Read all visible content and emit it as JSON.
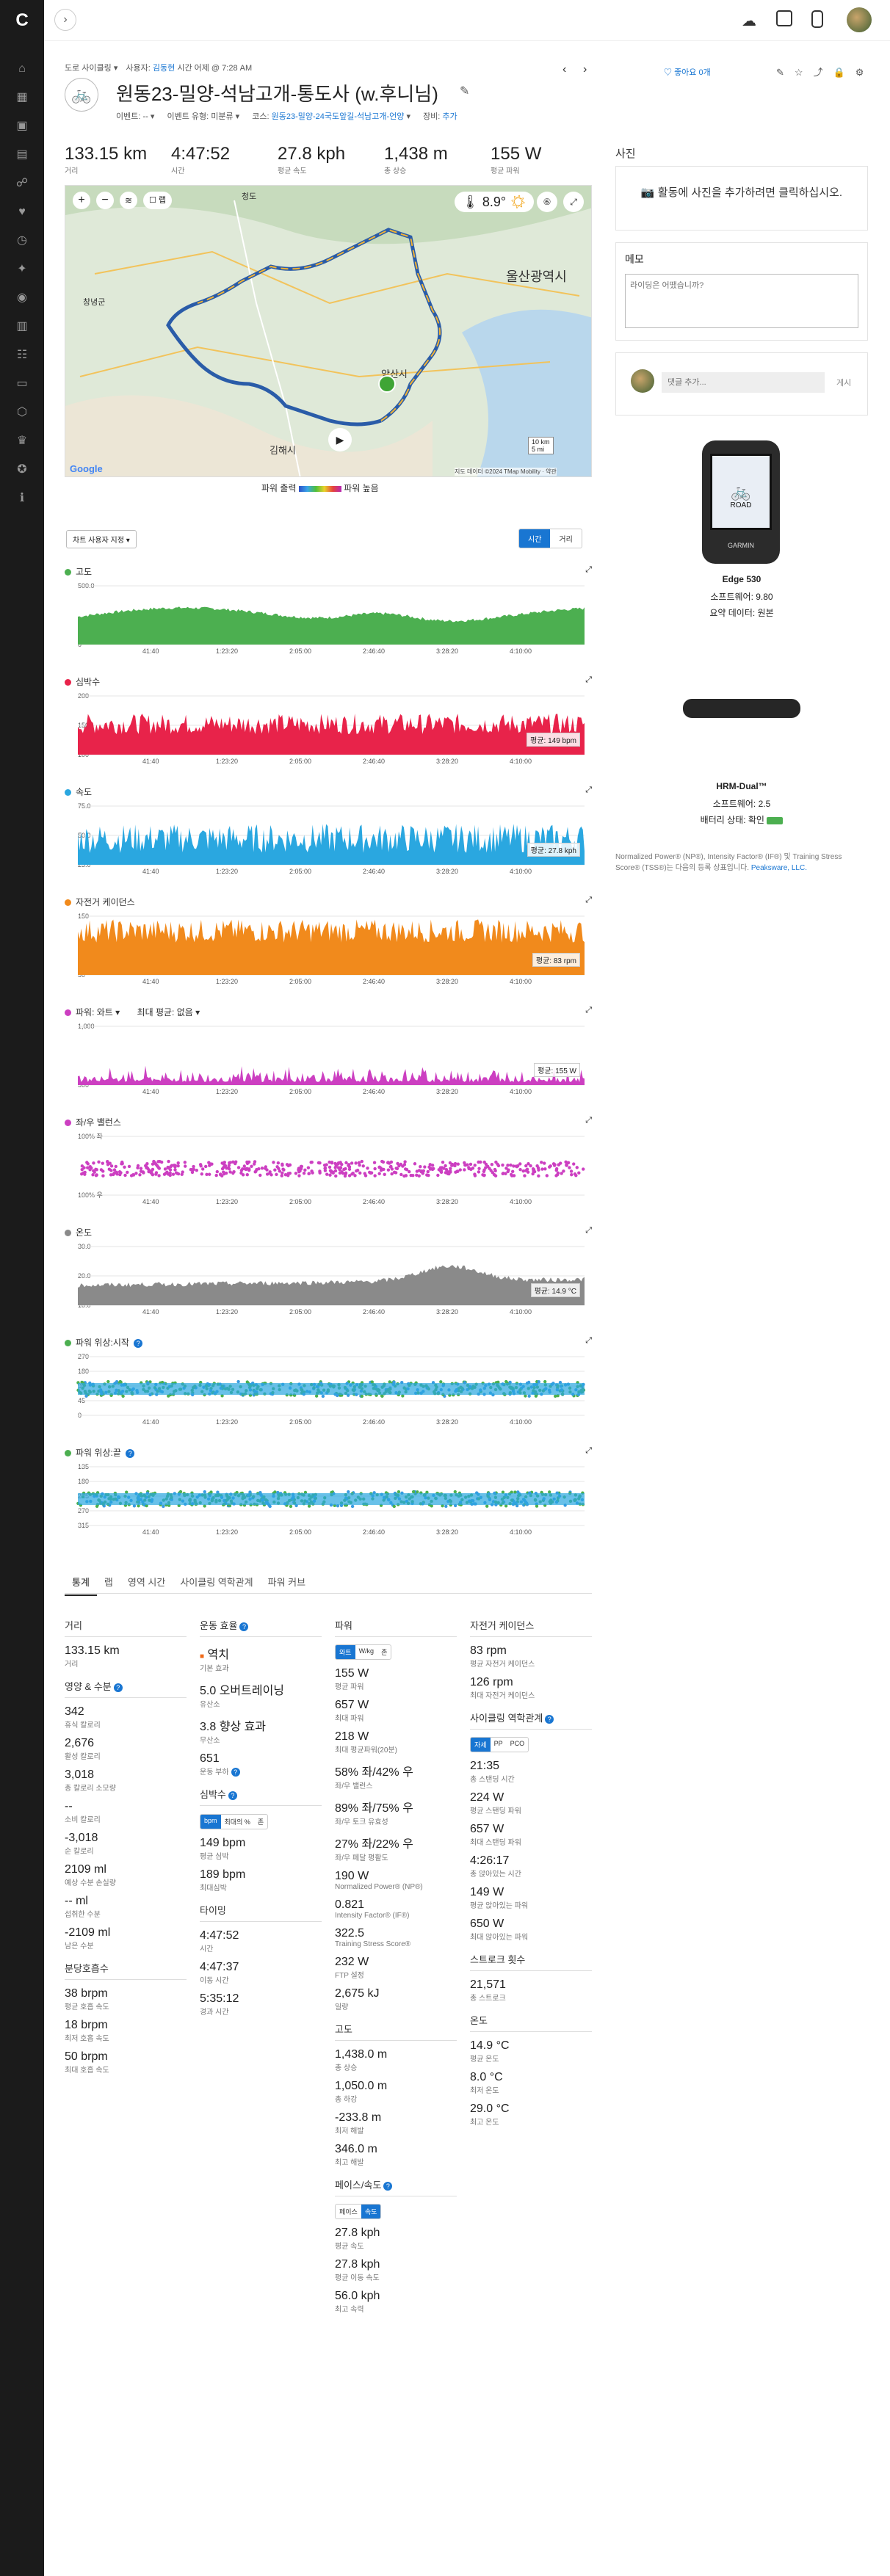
{
  "nav": {
    "items": [
      "home-icon",
      "activity-icon",
      "calendar-icon",
      "report-icon",
      "runner-icon",
      "heart-icon",
      "timer-icon",
      "lightbulb-icon",
      "location-icon",
      "chart-icon",
      "group-icon",
      "folder-icon",
      "badge-icon",
      "trophy-icon",
      "settings-icon",
      "info-icon"
    ]
  },
  "header": {
    "breadcrumb": "도로 사이클링",
    "owner_prefix": "사용자:",
    "owner": "김동현",
    "time_text": "시간 어제 @ 7:28 AM",
    "title": "원동23-밀양-석남고개-통도사 (w.후니님)",
    "events_label": "이벤트:",
    "events_value": "--",
    "event_type_label": "이벤트 유형:",
    "event_type_value": "미분류",
    "course_label": "코스:",
    "course_value": "원동23-밀양-24국도앞길-석남고개-언양",
    "gear_label": "장비:",
    "gear_value": "추가",
    "likes": "좋아요 0개"
  },
  "summary": [
    {
      "value": "133.15 km",
      "label": "거리"
    },
    {
      "value": "4:47:52",
      "label": "시간"
    },
    {
      "value": "27.8 kph",
      "label": "평균 속도"
    },
    {
      "value": "1,438 m",
      "label": "총 상승"
    },
    {
      "value": "155 W",
      "label": "평균 파워"
    }
  ],
  "map": {
    "temp": "8.9°",
    "checkbox": "랩",
    "places": [
      "울산광역시",
      "양산시",
      "김해시",
      "창녕군",
      "청도"
    ],
    "scale_km": "10 km",
    "scale_mi": "5 mi",
    "attribution": "지도 데이터 ©2024 TMap Mobility",
    "terms": "약관",
    "legend_low": "파워 출력",
    "legend_high": "파워 높음"
  },
  "chart_controls": {
    "select": "차트 사용자 지정",
    "time": "시간",
    "distance": "거리"
  },
  "x_ticks": [
    "41:40",
    "1:23:20",
    "2:05:00",
    "2:46:40",
    "3:28:20",
    "4:10:00"
  ],
  "charts": [
    {
      "name": "elevation",
      "title": "고도",
      "color": "#4caf50",
      "y": [
        "500.0",
        "0"
      ],
      "avg": "",
      "pattern": "elev"
    },
    {
      "name": "heart-rate",
      "title": "심박수",
      "color": "#e8234a",
      "y": [
        "200",
        "150",
        "100"
      ],
      "avg": "평균: 149 bpm",
      "pattern": "hr"
    },
    {
      "name": "speed",
      "title": "속도",
      "color": "#2aa7e0",
      "y": [
        "75.0",
        "50.0",
        "25.0"
      ],
      "avg": "평균: 27.8 kph",
      "pattern": "spd"
    },
    {
      "name": "cadence",
      "title": "자전거 케이던스",
      "color": "#f18a1c",
      "y": [
        "150",
        "100",
        "50"
      ],
      "avg": "평균: 83 rpm",
      "pattern": "cad"
    },
    {
      "name": "power",
      "title": "파워: 와트",
      "extra": "최대 평균: 없음",
      "color": "#cc3fc1",
      "y": [
        "1,000",
        "500"
      ],
      "avg": "평균: 155 W",
      "pattern": "pwr"
    },
    {
      "name": "lr-balance",
      "title": "좌/우 밸런스",
      "color": "#cc3fc1",
      "y": [
        "100% 좌",
        "100% 우"
      ],
      "avg": "",
      "pattern": "bal"
    },
    {
      "name": "temperature",
      "title": "온도",
      "color": "#8a8a8a",
      "y": [
        "30.0",
        "20.0",
        "10.0"
      ],
      "avg": "평균: 14.9 °C",
      "pattern": "temp"
    },
    {
      "name": "power-phase-start",
      "title": "파워 위상:시작",
      "color": "#4caf50",
      "y": [
        "270",
        "180",
        "90",
        "45",
        "0"
      ],
      "avg": "",
      "pattern": "phase"
    },
    {
      "name": "power-phase-end",
      "title": "파워 위상:끝",
      "color": "#4caf50",
      "y": [
        "135",
        "180",
        "225",
        "270",
        "315"
      ],
      "avg": "",
      "pattern": "phase"
    }
  ],
  "tabs": [
    "통계",
    "랩",
    "영역 시간",
    "사이클링 역학관계",
    "파워 커브"
  ],
  "stats": {
    "distance": {
      "head": "거리",
      "items": [
        [
          "133.15 km",
          "거리"
        ]
      ]
    },
    "nutrition": {
      "head": "영양 & 수분",
      "items": [
        [
          "342",
          "휴식 칼로리"
        ],
        [
          "2,676",
          "활성 칼로리"
        ],
        [
          "3,018",
          "총 칼로리 소모량"
        ],
        [
          "--",
          "소비 칼로리"
        ],
        [
          "-3,018",
          "순 칼로리"
        ],
        [
          "2109 ml",
          "예상 수분 손실량"
        ],
        [
          "-- ml",
          "섭취한 수분"
        ],
        [
          "-2109 ml",
          "남은 수분"
        ]
      ]
    },
    "resp": {
      "head": "분당호흡수",
      "items": [
        [
          "38 brpm",
          "평균 호흡 속도"
        ],
        [
          "18 brpm",
          "최저 호흡 속도"
        ],
        [
          "50 brpm",
          "최대 호흡 속도"
        ]
      ]
    },
    "training": {
      "head": "운동 효율",
      "items": [
        [
          "역치",
          "기본 효과"
        ],
        [
          "5.0 오버트레이닝",
          "유산소"
        ],
        [
          "3.8 향상 효과",
          "무산소"
        ],
        [
          "651",
          "운동 부하"
        ]
      ]
    },
    "hr": {
      "head": "심박수",
      "toggle": [
        "bpm",
        "최대의 %",
        "존"
      ],
      "items": [
        [
          "149 bpm",
          "평균 심박"
        ],
        [
          "189 bpm",
          "최대심박"
        ]
      ]
    },
    "timing": {
      "head": "타이밍",
      "items": [
        [
          "4:47:52",
          "시간"
        ],
        [
          "4:47:37",
          "이동 시간"
        ],
        [
          "5:35:12",
          "경과 시간"
        ]
      ]
    },
    "power": {
      "head": "파워",
      "toggle": [
        "와트",
        "W/kg",
        "존"
      ],
      "items": [
        [
          "155 W",
          "평균 파워"
        ],
        [
          "657 W",
          "최대 파워"
        ],
        [
          "218 W",
          "최대 평균파워(20분)"
        ],
        [
          "58% 좌/42% 우",
          "좌/우 밸런스"
        ],
        [
          "89% 좌/75% 우",
          "좌/우 토크 유효성"
        ],
        [
          "27% 좌/22% 우",
          "좌/우 페달 평활도"
        ],
        [
          "190 W",
          "Normalized Power® (NP®)"
        ],
        [
          "0.821",
          "Intensity Factor® (IF®)"
        ],
        [
          "322.5",
          "Training Stress Score®"
        ],
        [
          "232 W",
          "FTP 설정"
        ],
        [
          "2,675 kJ",
          "일량"
        ]
      ]
    },
    "elev": {
      "head": "고도",
      "items": [
        [
          "1,438.0 m",
          "총 상승"
        ],
        [
          "1,050.0 m",
          "총 하강"
        ],
        [
          "-233.8 m",
          "최저 해발"
        ],
        [
          "346.0 m",
          "최고 해발"
        ]
      ]
    },
    "pace": {
      "head": "페이스/속도",
      "toggle": [
        "페이스",
        "속도"
      ],
      "items": [
        [
          "27.8 kph",
          "평균 속도"
        ],
        [
          "27.8 kph",
          "평균 이동 속도"
        ],
        [
          "56.0 kph",
          "최고 속력"
        ]
      ]
    },
    "cadence": {
      "head": "자전거 케이던스",
      "items": [
        [
          "83 rpm",
          "평균 자전거 케이던스"
        ],
        [
          "126 rpm",
          "최대 자전거 케이던스"
        ]
      ]
    },
    "dynamics": {
      "head": "사이클링 역학관계",
      "toggle": [
        "자세",
        "PP",
        "PCO"
      ],
      "items": [
        [
          "21:35",
          "총 스탠딩 시간"
        ],
        [
          "224 W",
          "평균 스탠딩 파워"
        ],
        [
          "657 W",
          "최대 스탠딩 파워"
        ],
        [
          "4:26:17",
          "총 앉아있는 시간"
        ],
        [
          "149 W",
          "평균 앉아있는 파워"
        ],
        [
          "650 W",
          "최대 앉아있는 파워"
        ]
      ]
    },
    "strokes": {
      "head": "스트로크 횟수",
      "items": [
        [
          "21,571",
          "총 스트로크"
        ]
      ]
    },
    "temp": {
      "head": "온도",
      "items": [
        [
          "14.9 °C",
          "평균 온도"
        ],
        [
          "8.0 °C",
          "최저 온도"
        ],
        [
          "29.0 °C",
          "최고 온도"
        ]
      ]
    }
  },
  "side": {
    "photos_head": "사진",
    "photos_text": "활동에 사진을 추가하려면 클릭하십시오.",
    "memo_head": "메모",
    "memo_placeholder": "라이딩은 어땠습니까?",
    "comment_placeholder": "댓글 추가...",
    "post": "게시",
    "device_name": "Edge 530",
    "device_sw": "소프트웨어: 9.80",
    "device_data": "요약 데이터: 원본",
    "device_screen": "ROAD",
    "device_brand": "GARMIN",
    "hrm_name": "HRM-Dual™",
    "hrm_sw": "소프트웨어: 2.5",
    "hrm_bat": "배터리 상태: 확인",
    "legal": "Normalized Power® (NP®), Intensity Factor® (IF®) 및 Training Stress Score® (TSS®)는 다음의 등록 상표입니다.",
    "legal_link": "Peaksware, LLC."
  }
}
